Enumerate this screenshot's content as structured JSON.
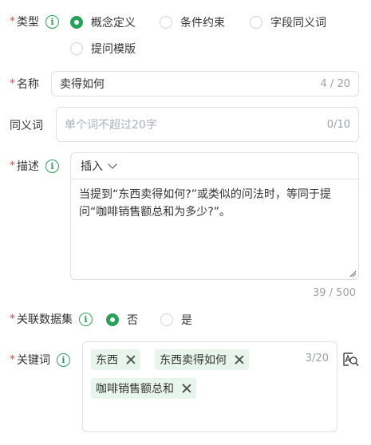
{
  "type_field": {
    "label": "类型",
    "options": [
      {
        "label": "概念定义",
        "selected": true
      },
      {
        "label": "条件约束",
        "selected": false
      },
      {
        "label": "字段同义词",
        "selected": false
      },
      {
        "label": "提问模版",
        "selected": false
      }
    ]
  },
  "name_field": {
    "label": "名称",
    "value": "卖得如何",
    "counter": "4 / 20"
  },
  "synonym_field": {
    "label": "同义词",
    "placeholder": "单个词不超过20字",
    "counter": "0/10"
  },
  "description_field": {
    "label": "描述",
    "insert_label": "插入",
    "text": "当提到“东西卖得如何?”或类似的问法时，等同于提问“咖啡销售额总和为多少?”。",
    "counter": "39 / 500"
  },
  "dataset_field": {
    "label": "关联数据集",
    "options": [
      {
        "label": "否",
        "selected": true
      },
      {
        "label": "是",
        "selected": false
      }
    ]
  },
  "keyword_field": {
    "label": "关键词",
    "tags": [
      "东西",
      "东西卖得如何",
      "咖啡销售额总和"
    ],
    "counter": "3/20",
    "action_icon": "text-search-icon"
  },
  "required_mark": "*",
  "info_glyph": "i",
  "colors": {
    "accent": "#27a05a",
    "required": "#e5484d",
    "tag_bg": "#e8f5ec"
  }
}
